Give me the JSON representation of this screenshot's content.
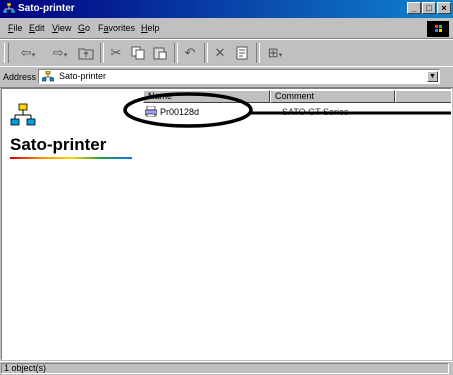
{
  "window": {
    "title": "Sato-printer",
    "controls": [
      "_",
      "□",
      "×"
    ]
  },
  "menu": {
    "items": [
      "File",
      "Edit",
      "View",
      "Go",
      "Favorites",
      "Help"
    ],
    "accel": [
      "F",
      "E",
      "V",
      "G",
      "a",
      "H"
    ]
  },
  "toolbar": {
    "buttons": [
      "back",
      "forward",
      "up",
      "cut",
      "copy",
      "paste",
      "undo",
      "delete",
      "properties",
      "views"
    ]
  },
  "address": {
    "label": "Address",
    "value": "Sato-printer",
    "icon": "network-folder-icon"
  },
  "left_panel": {
    "folder_title": "Sato-printer",
    "icon": "network-icon"
  },
  "list": {
    "columns": [
      "Name",
      "Comment"
    ],
    "rows": [
      {
        "name": "Pr00128d",
        "comment": "SATO GT Series",
        "icon": "printer-icon"
      }
    ]
  },
  "status": {
    "text": "1 object(s)"
  },
  "annotation": {
    "shape": "ellipse",
    "color": "#000000"
  }
}
